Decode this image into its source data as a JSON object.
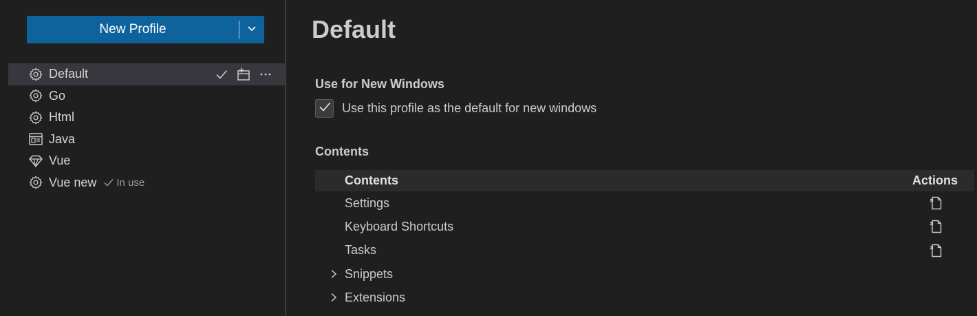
{
  "sidebar": {
    "new_profile_label": "New Profile",
    "profiles": [
      {
        "name": "Default",
        "icon": "gear-icon",
        "selected": true
      },
      {
        "name": "Go",
        "icon": "gear-icon"
      },
      {
        "name": "Html",
        "icon": "gear-icon"
      },
      {
        "name": "Java",
        "icon": "window-icon"
      },
      {
        "name": "Vue",
        "icon": "diamond-icon"
      },
      {
        "name": "Vue new",
        "icon": "gear-icon",
        "status": "In use"
      }
    ]
  },
  "main": {
    "title": "Default",
    "use_for_new_windows": {
      "heading": "Use for New Windows",
      "checkbox_label": "Use this profile as the default for new windows",
      "checked": true
    },
    "contents": {
      "heading": "Contents",
      "columns": [
        "Contents",
        "Actions"
      ],
      "rows": [
        {
          "label": "Settings",
          "expandable": false,
          "action_icon": "open-file-icon"
        },
        {
          "label": "Keyboard Shortcuts",
          "expandable": false,
          "action_icon": "open-file-icon"
        },
        {
          "label": "Tasks",
          "expandable": false,
          "action_icon": "open-file-icon"
        },
        {
          "label": "Snippets",
          "expandable": true
        },
        {
          "label": "Extensions",
          "expandable": true
        }
      ]
    }
  },
  "colors": {
    "background": "#1f1f1f",
    "button": "#0e639c",
    "selected_row": "#37373d",
    "table_header": "#2b2b2b"
  }
}
